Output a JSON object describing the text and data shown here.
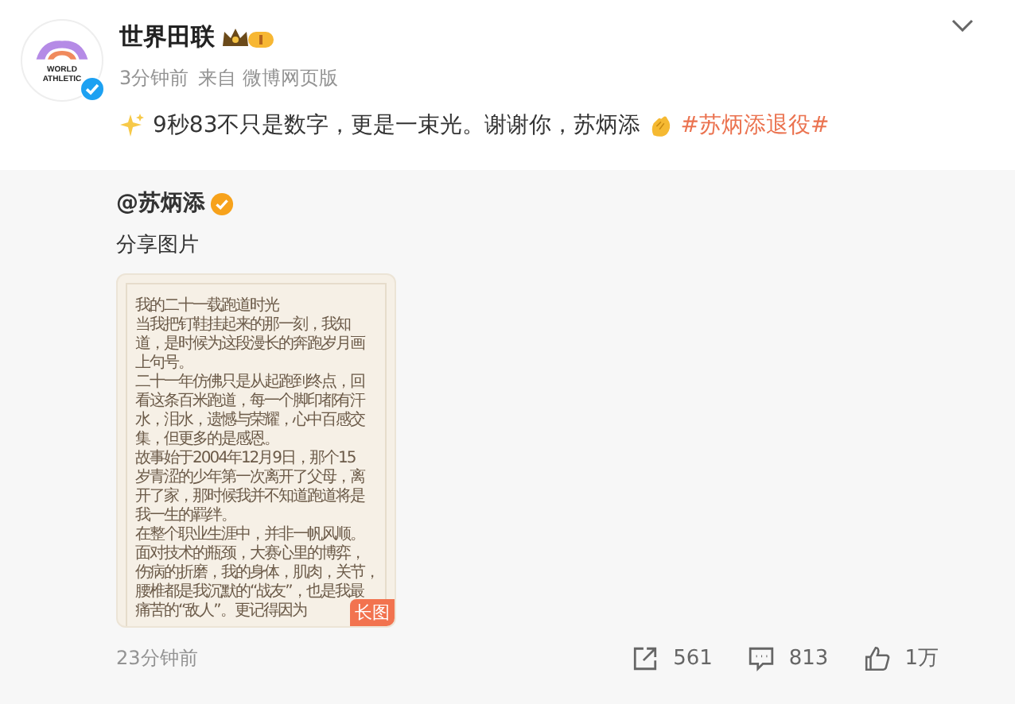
{
  "author": {
    "name": "世界田联",
    "logo_text": [
      "WORLD",
      "ATHLETIC"
    ],
    "verified": true,
    "time": "3分钟前",
    "source": "来自 微博网页版"
  },
  "post": {
    "text": "9秒83不只是数字，更是一束光。谢谢你，苏炳添",
    "hashtag": "#苏炳添退役#"
  },
  "repost": {
    "author": "@苏炳添",
    "verified": true,
    "text": "分享图片",
    "image": {
      "title": "我的二十一载跑道时光",
      "lines": [
        "当我把钉鞋挂起来的那一刻，我知",
        "道，是时候为这段漫长的奔跑岁月画",
        "上句号。",
        "二十一年仿佛只是从起跑到终点，回",
        "看这条百米跑道，每一个脚印都有汗",
        "水，泪水，遗憾与荣耀，心中百感交",
        "集，但更多的是感恩。",
        "故事始于2004年12月9日，那个15",
        "岁青涩的少年第一次离开了父母，离",
        "开了家，那时候我并不知道跑道将是",
        "我一生的羁绊。",
        "在整个职业生涯中，并非一帆风顺。",
        "面对技术的瓶颈，大赛心里的博弈，",
        "伤病的折磨，我的身体，肌肉，关节，",
        "腰椎都是我沉默的“战友”，也是我最",
        "痛苦的“敌人”。更记得因为"
      ],
      "badge": "长图"
    },
    "time": "23分钟前",
    "stats": [
      {
        "kind": "share",
        "count": "561"
      },
      {
        "kind": "comment",
        "count": "813"
      },
      {
        "kind": "like",
        "count": "1万"
      }
    ]
  }
}
